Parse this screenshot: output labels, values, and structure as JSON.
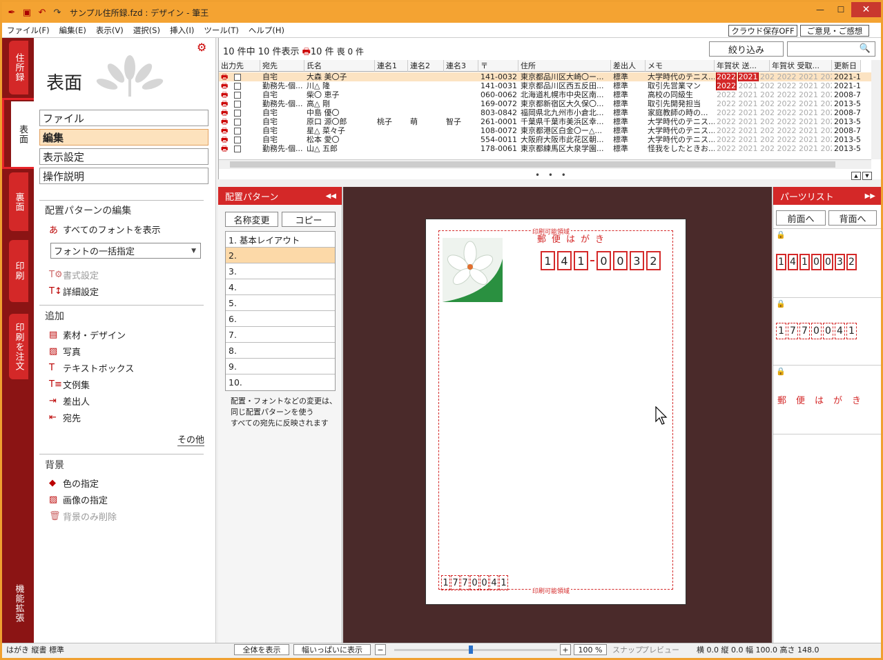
{
  "window": {
    "title": "サンプル住所録.fzd : デザイン - 筆王"
  },
  "menu": [
    "ファイル(F)",
    "編集(E)",
    "表示(V)",
    "選択(S)",
    "挿入(I)",
    "ツール(T)",
    "ヘルプ(H)"
  ],
  "menu_right": {
    "cloud": "クラウド保存OFF",
    "feedback": "ご意見・ご感想"
  },
  "side_tabs": {
    "address": "住所録",
    "front": "表面",
    "back": "裏面",
    "print": "印刷",
    "order": "印刷を注文",
    "extend": "機能拡張"
  },
  "left_panel": {
    "title": "表面",
    "buttons": {
      "file": "ファイル",
      "edit": "編集",
      "display": "表示設定",
      "help": "操作説明"
    },
    "section_layout": "配置パターンの編集",
    "show_fonts": "すべてのフォントを表示",
    "font_select": "フォントの一括指定",
    "format_setting": "書式設定",
    "detail_setting": "詳細設定",
    "section_add": "追加",
    "add_items": [
      "素材・デザイン",
      "写真",
      "テキストボックス",
      "文例集",
      "差出人",
      "宛先"
    ],
    "more": "その他",
    "section_bg": "背景",
    "bg_color": "色の指定",
    "bg_image": "画像の指定",
    "bg_delete": "背景のみ削除"
  },
  "table": {
    "count_prefix": "10 件中 10 件表示",
    "count_mark": "10 件",
    "mourning": "喪 0 件",
    "filter": "絞り込み",
    "columns": [
      "出力先",
      "宛先",
      "氏名",
      "連名1",
      "連名2",
      "連名3",
      "〒",
      "住所",
      "差出人",
      "メモ",
      "年賀状 送...",
      "年賀状 受取...",
      "更新日"
    ],
    "year_text": "2022 2021 202 2022 2021 2020",
    "rows": [
      {
        "dest": "自宅",
        "name": "大森 美〇子",
        "ren1": "",
        "ren2": "",
        "ren3": "",
        "zip": "141-0032",
        "addr": "東京都品川区大崎〇ー...",
        "sender": "標準",
        "memo": "大学時代のテニス...",
        "y1": "2022",
        "y2": "2021",
        "upd": "2021-11"
      },
      {
        "dest": "勤務先-個...",
        "name": "川△ 隆",
        "ren1": "",
        "ren2": "",
        "ren3": "",
        "zip": "141-0031",
        "addr": "東京都品川区西五反田...",
        "sender": "標準",
        "memo": "取引先営業マン",
        "y1": "2022",
        "y2": "",
        "upd": "2021-11"
      },
      {
        "dest": "自宅",
        "name": "柴〇 恵子",
        "ren1": "",
        "ren2": "",
        "ren3": "",
        "zip": "060-0062",
        "addr": "北海道札幌市中央区南...",
        "sender": "標準",
        "memo": "高校の同級生",
        "y1": "",
        "y2": "",
        "upd": "2008-7"
      },
      {
        "dest": "勤務先-個...",
        "name": "高△ 剛",
        "ren1": "",
        "ren2": "",
        "ren3": "",
        "zip": "169-0072",
        "addr": "東京都新宿区大久保〇...",
        "sender": "標準",
        "memo": "取引先開発担当",
        "y1": "",
        "y2": "",
        "upd": "2013-5"
      },
      {
        "dest": "自宅",
        "name": "中島 優〇",
        "ren1": "",
        "ren2": "",
        "ren3": "",
        "zip": "803-0842",
        "addr": "福岡県北九州市小倉北...",
        "sender": "標準",
        "memo": "家庭教師の時の...",
        "y1": "",
        "y2": "",
        "upd": "2008-7"
      },
      {
        "dest": "自宅",
        "name": "原口 源〇郎",
        "ren1": "桃子",
        "ren2": "萌",
        "ren3": "智子",
        "zip": "261-0001",
        "addr": "千葉県千葉市美浜区幸...",
        "sender": "標準",
        "memo": "大学時代のテニス...",
        "y1": "",
        "y2": "",
        "upd": "2013-5"
      },
      {
        "dest": "自宅",
        "name": "星△ 菜々子",
        "ren1": "",
        "ren2": "",
        "ren3": "",
        "zip": "108-0072",
        "addr": "東京都港区白金〇ー△...",
        "sender": "標準",
        "memo": "大学時代のテニス...",
        "y1": "",
        "y2": "",
        "upd": "2008-7"
      },
      {
        "dest": "自宅",
        "name": "松本 愛〇",
        "ren1": "",
        "ren2": "",
        "ren3": "",
        "zip": "554-0011",
        "addr": "大阪府大阪市此花区朝...",
        "sender": "標準",
        "memo": "大学時代のテニス...",
        "y1": "",
        "y2": "",
        "upd": "2013-5"
      },
      {
        "dest": "勤務先-個...",
        "name": "山△ 五郎",
        "ren1": "",
        "ren2": "",
        "ren3": "",
        "zip": "178-0061",
        "addr": "東京都練馬区大泉学園...",
        "sender": "標準",
        "memo": "怪我をしたときお...",
        "y1": "",
        "y2": "",
        "upd": "2013-5"
      }
    ]
  },
  "pattern_panel": {
    "title": "配置パターン",
    "rename": "名称変更",
    "copy": "コピー",
    "items": [
      "1. 基本レイアウト",
      "2.",
      "3.",
      "4.",
      "5.",
      "6.",
      "7.",
      "8.",
      "9.",
      "10."
    ],
    "selected_index": 1,
    "note": [
      "配置・フォントなどの変更は、",
      "同じ配置パターンを使う",
      "すべての宛先に反映されます"
    ]
  },
  "card": {
    "print_area": "印刷可能領域",
    "yubin": "郵便はがき",
    "zip_digits": [
      "1",
      "4",
      "1",
      "0",
      "0",
      "3",
      "2"
    ],
    "sender_zip": [
      "1",
      "7",
      "7",
      "0",
      "0",
      "4",
      "1"
    ]
  },
  "parts_panel": {
    "title": "パーツリスト",
    "front": "前面へ",
    "back": "背面へ",
    "zip_digits": [
      "1",
      "4",
      "1",
      "0",
      "0",
      "3",
      "2"
    ],
    "sender_zip": [
      "1",
      "7",
      "7",
      "0",
      "0",
      "4",
      "1"
    ],
    "yubin": "郵便はがき"
  },
  "status": {
    "left": "はがき 縦書 標準",
    "fit_all": "全体を表示",
    "fit_width": "幅いっぱいに表示",
    "minus": "−",
    "plus": "+",
    "zoom": "100 %",
    "snap": "スナップ",
    "preview": "プレビュー",
    "coords": "横 0.0 縦 0.0  幅 100.0 高さ 148.0",
    "zoom_fraction": 0.47
  },
  "colors": {
    "accent": "#d42828",
    "sidebar": "#8b1414",
    "title_bar": "#f4a332",
    "canvas": "#4a2a2a"
  }
}
